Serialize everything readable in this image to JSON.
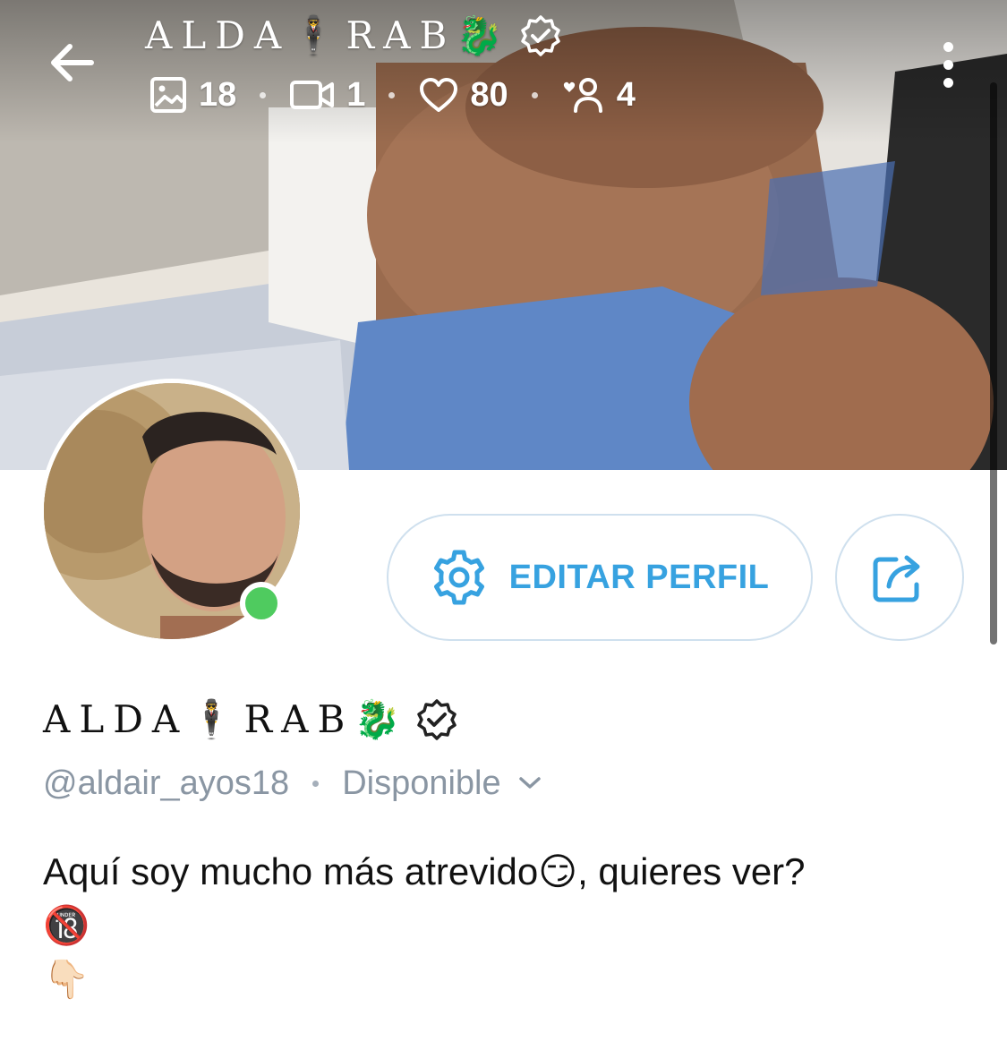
{
  "header": {
    "title": "ALDA🕴RAB🐉",
    "verified_icon": "verified-badge-icon",
    "stats": {
      "photos": "18",
      "videos": "1",
      "likes": "80",
      "subscribers": "4"
    },
    "icons": {
      "back": "arrow-left-icon",
      "photos": "image-icon",
      "videos": "video-icon",
      "likes": "heart-icon",
      "subscribers": "fans-icon",
      "more": "more-vertical-icon"
    }
  },
  "profile": {
    "display_name": "ALDA🕴RAB🐉",
    "handle": "@aldair_ayos18",
    "status": "Disponible",
    "online": true,
    "bio": {
      "line1_a": "Aquí soy mucho más atrevido",
      "line1_emoji": "😏",
      "line1_b": ", quieres ver?",
      "line2": "🔞",
      "line3": "👇🏻"
    }
  },
  "actions": {
    "edit_label": "EDITAR PERFIL",
    "share_icon": "share-icon"
  },
  "colors": {
    "accent": "#37a2e0",
    "online": "#4fcb5f",
    "muted_text": "#8a96a3",
    "button_border": "#cfe0ee"
  }
}
